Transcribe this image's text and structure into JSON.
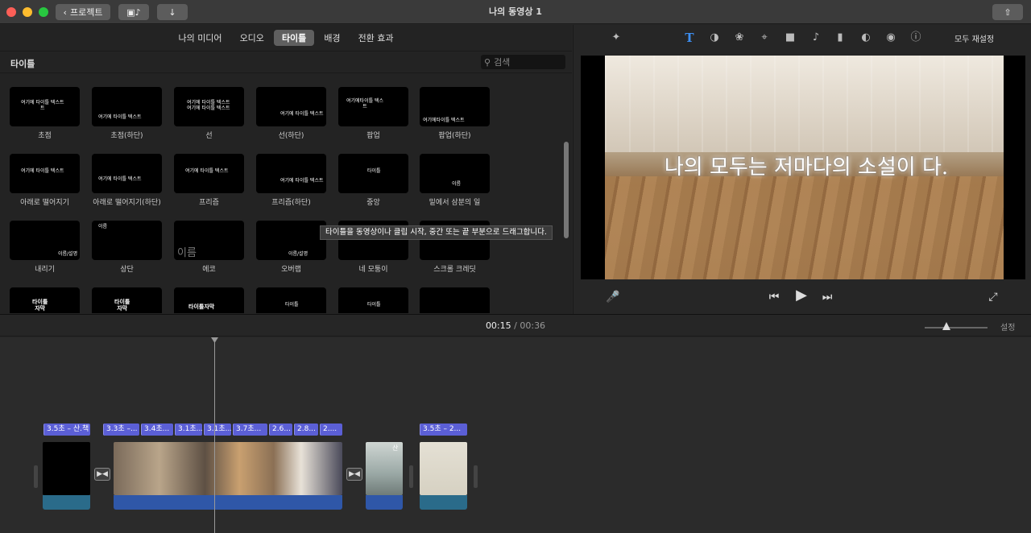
{
  "window": {
    "title": "나의 동영상 1",
    "back_label": "프로젝트"
  },
  "browser": {
    "tabs": [
      {
        "label": "나의 미디어",
        "active": false
      },
      {
        "label": "오디오",
        "active": false
      },
      {
        "label": "타이틀",
        "active": true
      },
      {
        "label": "배경",
        "active": false
      },
      {
        "label": "전환 효과",
        "active": false
      }
    ],
    "section_label": "타이틀",
    "search_placeholder": "검색",
    "tooltip": "타이틀을 동영상이나 클립 시작, 중간 또는 끝 부분으로 드래그합니다.",
    "tiles": [
      {
        "label": "초점",
        "thumb": "여기에 타이틀 텍스트\n트"
      },
      {
        "label": "초점(하단)",
        "thumb": "여기에 타이틀 텍스트"
      },
      {
        "label": "선",
        "thumb": "여기에 타이틀 텍스트\n여기에 타이틀 텍스트"
      },
      {
        "label": "선(하단)",
        "thumb": "여기에 타이틀 텍스트"
      },
      {
        "label": "팝업",
        "thumb": "여기에타이틀 텍스\n트"
      },
      {
        "label": "팝업(하단)",
        "thumb": "여기에타이틀 텍스트"
      },
      {
        "label": "아래로 떨어지기",
        "thumb": "여기에 타이틀 텍스트"
      },
      {
        "label": "아래로 떨어지기(하단)",
        "thumb": "여기에 타이틀 텍스트"
      },
      {
        "label": "프리즘",
        "thumb": "여기에 타이틀 텍스트"
      },
      {
        "label": "프리즘(하단)",
        "thumb": "여기에 타이틀 텍스트"
      },
      {
        "label": "중앙",
        "thumb": "타이틀"
      },
      {
        "label": "밑에서 삼분의 일",
        "thumb": "이름"
      },
      {
        "label": "내리기",
        "thumb": "이름/설명"
      },
      {
        "label": "상단",
        "thumb": "이름"
      },
      {
        "label": "에코",
        "thumb": "이름"
      },
      {
        "label": "오버랩",
        "thumb": "이름/설명"
      },
      {
        "label": "네 모퉁이",
        "thumb": ""
      },
      {
        "label": "스크롤 크레딧",
        "thumb": ""
      },
      {
        "label": "",
        "thumb": "타이틀\n자막"
      },
      {
        "label": "",
        "thumb": "타이틀\n자막"
      },
      {
        "label": "",
        "thumb": "타이틀자막"
      },
      {
        "label": "",
        "thumb": "타이틀"
      },
      {
        "label": "",
        "thumb": "타이틀"
      },
      {
        "label": "",
        "thumb": ""
      }
    ]
  },
  "viewer": {
    "reset_label": "모두 재설정",
    "caption": "나의 모두는 저마다의 소설이 다.",
    "tools": [
      "magic-wand-icon",
      "text-T-icon",
      "color-balance-icon",
      "color-palette-icon",
      "crop-icon",
      "camera-icon",
      "volume-icon",
      "equalizer-icon",
      "speed-icon",
      "filter-icon",
      "info-icon"
    ]
  },
  "timeline": {
    "current": "00:15",
    "separator": "/",
    "total": "00:36",
    "settings_label": "설정",
    "title_tags": [
      "3.5초 – 산.책",
      "3.3초 –...",
      "3.4초...",
      "3.1초...",
      "3.1초...",
      "3.7초...",
      "2.6...",
      "2.8...",
      "2....",
      "3.5초 – 2..."
    ],
    "clip_label_small": "산"
  }
}
